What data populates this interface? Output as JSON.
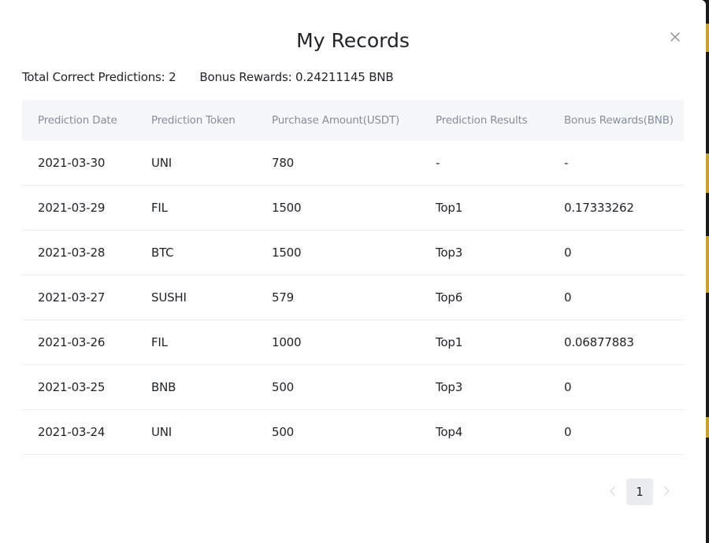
{
  "colors": {
    "text_primary": "#1e2329",
    "text_secondary": "#848e9c",
    "header_bg": "#f6f7f9",
    "divider": "#eaecef",
    "accent": "#c9a227"
  },
  "icons": {
    "close": "close-icon",
    "prev": "chevron-left-icon",
    "next": "chevron-right-icon"
  },
  "modal": {
    "title": "My Records"
  },
  "summary": {
    "correct": "Total Correct Predictions: 2",
    "rewards": "Bonus Rewards: 0.24211145 BNB"
  },
  "table": {
    "headers": [
      "Prediction Date",
      "Prediction Token",
      "Purchase Amount(USDT)",
      "Prediction Results",
      "Bonus Rewards(BNB)"
    ],
    "rows": [
      [
        "2021-03-30",
        "UNI",
        "780",
        "-",
        "-"
      ],
      [
        "2021-03-29",
        "FIL",
        "1500",
        "Top1",
        "0.17333262"
      ],
      [
        "2021-03-28",
        "BTC",
        "1500",
        "Top3",
        "0"
      ],
      [
        "2021-03-27",
        "SUSHI",
        "579",
        "Top6",
        "0"
      ],
      [
        "2021-03-26",
        "FIL",
        "1000",
        "Top1",
        "0.06877883"
      ],
      [
        "2021-03-25",
        "BNB",
        "500",
        "Top3",
        "0"
      ],
      [
        "2021-03-24",
        "UNI",
        "500",
        "Top4",
        "0"
      ]
    ]
  },
  "pagination": {
    "current": "1"
  }
}
